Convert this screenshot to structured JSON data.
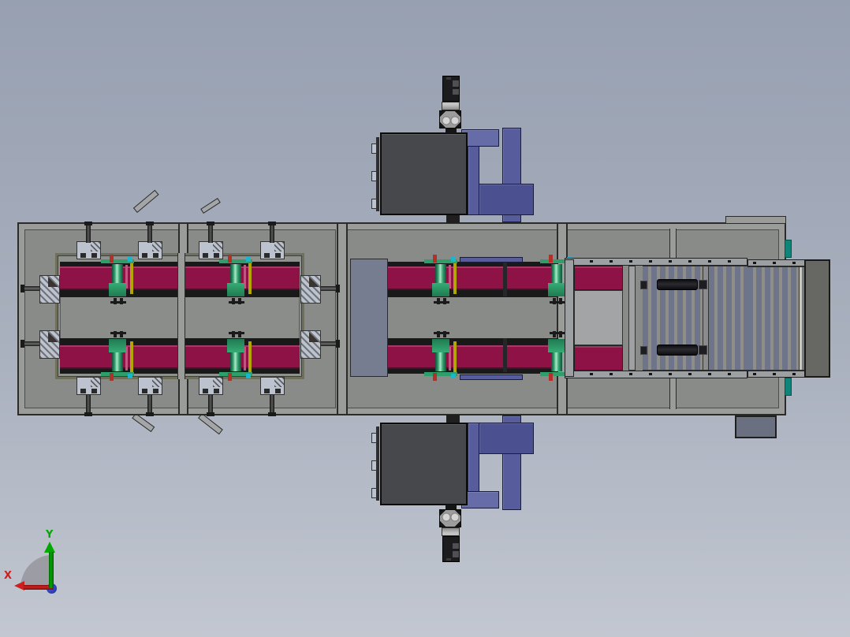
{
  "viewport": {
    "type": "cad-top-view",
    "axis_triad": {
      "x_label": "X",
      "y_label": "Y"
    }
  },
  "colors": {
    "bg_top": "#97A0B1",
    "bg_mid": "#A9B0BE",
    "bg_bottom": "#C2C7D0",
    "frame_wall": "#9A9C9A",
    "frame_line": "#2B2B2B",
    "interior": "#898B89",
    "inner_frame_border": "#6E705C",
    "crimson": "#8E1245",
    "rail": "#191919",
    "green": "#2F9E6A",
    "yellow": "#B3A603",
    "pink": "#C2557E",
    "red_pin": "#B23028",
    "cyan_pin": "#19B7C9",
    "plate": "#BCC3CF",
    "purple": "#565C9C",
    "purple_light": "#666CA8",
    "purple_dark": "#4B5090",
    "purple_outline": "#181A3E",
    "box_dark": "#46484C",
    "motor_black": "#1C1C1E",
    "gripper": "#9C9C9C",
    "blue_panel": "#767D90",
    "stripe_blue": "#6E7489",
    "stripe_tan": "#8F8D87",
    "teal": "#0E8578",
    "slate": "#6A7080",
    "end_panel": "#676763",
    "lift_bar": "#9CA0A2",
    "axis_x": "#CC2020",
    "axis_y": "#00A800",
    "axis_z": "#2A3FD0"
  }
}
